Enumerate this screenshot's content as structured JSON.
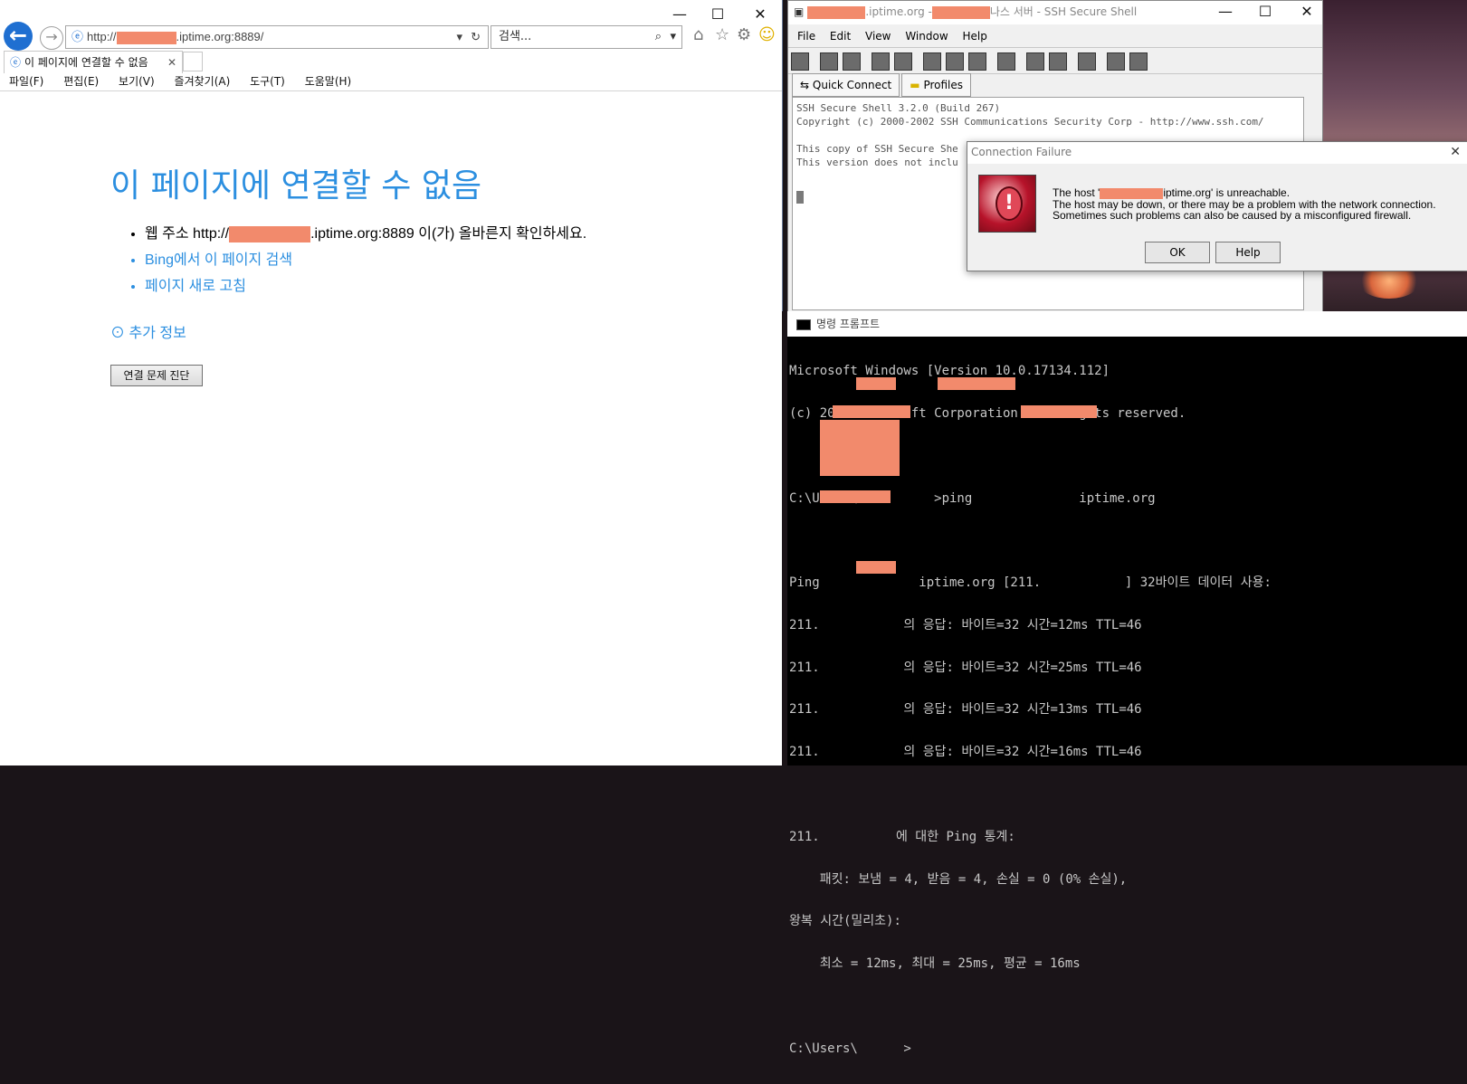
{
  "ie": {
    "address": {
      "prefix": "http://",
      "host_suffix": ".iptime.org:8889/"
    },
    "search_placeholder": "검색...",
    "tab_title": "이 페이지에 연결할 수 없음",
    "menu": [
      "파일(F)",
      "편집(E)",
      "보기(V)",
      "즐겨찾기(A)",
      "도구(T)",
      "도움말(H)"
    ],
    "error_title": "이 페이지에 연결할 수 없음",
    "bullets": {
      "address_prefix": "웹 주소 http://",
      "address_suffix": ".iptime.org:8889 이(가) 올바른지 확인하세요.",
      "bing": "Bing에서 이 페이지 검색",
      "refresh": "페이지 새로 고침"
    },
    "more_info": "추가 정보",
    "diagnose_button": "연결 문제 진단"
  },
  "ssh": {
    "title_host": ".iptime.org -",
    "title_rest": "나스 서버 - SSH Secure Shell",
    "menu": [
      "File",
      "Edit",
      "View",
      "Window",
      "Help"
    ],
    "quick_connect": "Quick Connect",
    "profiles": "Profiles",
    "term_lines": [
      "SSH Secure Shell 3.2.0 (Build 267)",
      "Copyright (c) 2000-2002 SSH Communications Security Corp - http://www.ssh.com/",
      "",
      "This copy of SSH Secure She",
      "This version does not inclu"
    ]
  },
  "dialog": {
    "title": "Connection Failure",
    "line1_prefix": "The host '",
    "line1_suffix": "iptime.org' is unreachable.",
    "line2": "The host may be down, or there may be a problem with the network connection.",
    "line3": "Sometimes such problems can also be caused by a misconfigured firewall.",
    "ok": "OK",
    "help": "Help"
  },
  "cmd": {
    "title": "명령 프롬프트",
    "lines": [
      "Microsoft Windows [Version 10.0.17134.112]",
      "(c) 2018 Microsoft Corporation. All rights reserved.",
      "",
      "C:\\Users\\          >ping              iptime.org",
      "",
      "Ping             iptime.org [211.           ] 32바이트 데이터 사용:",
      "211.           의 응답: 바이트=32 시간=12ms TTL=46",
      "211.           의 응답: 바이트=32 시간=25ms TTL=46",
      "211.           의 응답: 바이트=32 시간=13ms TTL=46",
      "211.           의 응답: 바이트=32 시간=16ms TTL=46",
      "",
      "211.          에 대한 Ping 통계:",
      "    패킷: 보냄 = 4, 받음 = 4, 손실 = 0 (0% 손실),",
      "왕복 시간(밀리초):",
      "    최소 = 12ms, 최대 = 25ms, 평균 = 16ms",
      "",
      "C:\\Users\\      >"
    ]
  },
  "colors": {
    "link": "#2c8fe0",
    "redaction": "#f28a6c"
  }
}
